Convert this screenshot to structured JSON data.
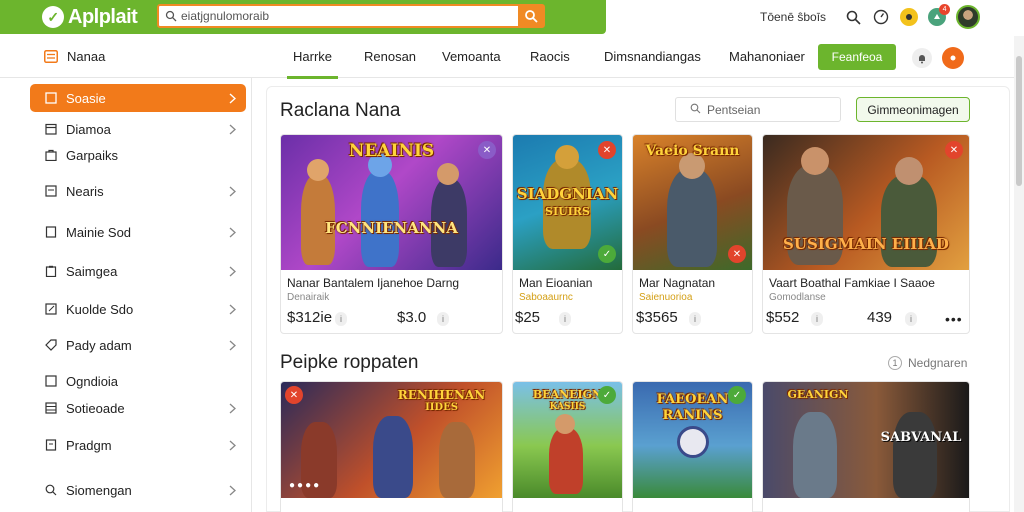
{
  "app": {
    "name": "Aplplait",
    "search_value": "eiatjgnulomoraib"
  },
  "topbar": {
    "text": "Tōenē ŝboīs",
    "badge": "4"
  },
  "nav": {
    "title": "Nanaa",
    "tabs": [
      "Harrke",
      "Renosan",
      "Vemoanta",
      "Raocis",
      "Dimsnandiangas",
      "Mahanoniaer"
    ],
    "cta": "Feanfeoa"
  },
  "sidebar": {
    "items": [
      {
        "label": "Soasie"
      },
      {
        "label": "Diamoa"
      },
      {
        "label": "Garpaiks"
      },
      {
        "label": "Nearis"
      },
      {
        "label": "Mainie Sod"
      },
      {
        "label": "Saimgea"
      },
      {
        "label": "Kuolde Sdo"
      },
      {
        "label": "Pady adam"
      },
      {
        "label": "Ogndioia"
      },
      {
        "label": "Sotieoade"
      },
      {
        "label": "Pradgm"
      },
      {
        "label": "Siomengan"
      }
    ]
  },
  "section1": {
    "title": "Raclana Nana",
    "search_placeholder": "Pentseian",
    "button": "Gimmeonimagen",
    "cards": [
      {
        "art_title": "NEAINIS",
        "art_sub": "FCNNIENANNA",
        "name": "Nanar Bantalem Ijanehoe Darng",
        "sub": "Denairaik",
        "price1": "$312ie",
        "price2": "$3.0"
      },
      {
        "art_title": "SIADGNIAN",
        "art_sub": "SIUIRS",
        "name": "Man Eioanian",
        "sub": "Saboaaurnc",
        "price1": "$25"
      },
      {
        "art_title": "Vaeio Srann",
        "art_sub": "",
        "name": "Mar Nagnatan",
        "sub": "Saienuorioa",
        "price1": "$3565"
      },
      {
        "art_title": "SUSIGMAIN EIIIAD",
        "art_sub": "",
        "name": "Vaart Boathal Famkiae I Saaoe",
        "sub": "Gomodlanse",
        "price1": "$552",
        "price2": "439"
      }
    ]
  },
  "section2": {
    "title": "Peipke roppaten",
    "link": "Nedgnaren",
    "cards": [
      {
        "art_title": "RENIHENAN",
        "art_sub": "IIDES"
      },
      {
        "art_title": "BEANEIGN",
        "art_sub": "KASIIS"
      },
      {
        "art_title": "FAEOEAN",
        "art_sub": "RANINS"
      },
      {
        "art_title": "GEANIGN",
        "art_sub": "SABVANAL"
      }
    ]
  },
  "colors": {
    "green": "#6cb52d",
    "orange": "#f27a1a"
  }
}
